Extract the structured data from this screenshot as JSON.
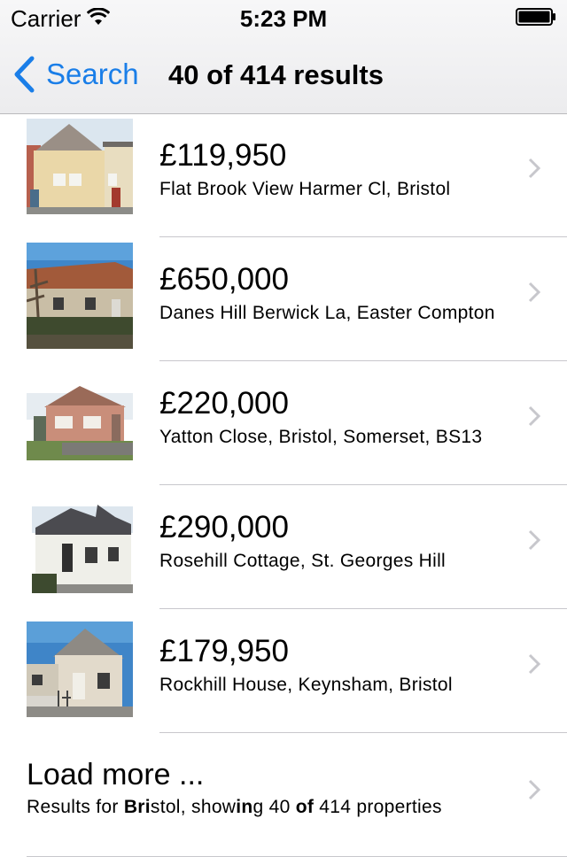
{
  "status_bar": {
    "carrier": "Carrier",
    "time": "5:23 PM"
  },
  "nav": {
    "back_label": "Search",
    "title": "40 of 414 results"
  },
  "listings": [
    {
      "price": "£119,950",
      "address": "Flat Brook View Harmer Cl, Bristol"
    },
    {
      "price": "£650,000",
      "address": "Danes Hill Berwick La, Easter Compton"
    },
    {
      "price": "£220,000",
      "address": "Yatton Close, Bristol, Somerset, BS13"
    },
    {
      "price": "£290,000",
      "address": "Rosehill Cottage, St. Georges Hill"
    },
    {
      "price": "£179,950",
      "address": "Rockhill House, Keynsham, Bristol"
    }
  ],
  "load_more": {
    "title": "Load more ...",
    "subtitle_parts": [
      "Results for ",
      "Bri",
      "stol, show",
      "in",
      "g 40 ",
      "of",
      " 414 properties"
    ]
  },
  "colors": {
    "accent": "#1a7ee8",
    "separator": "#c8c7cc",
    "chevron": "#c7c7cc"
  }
}
